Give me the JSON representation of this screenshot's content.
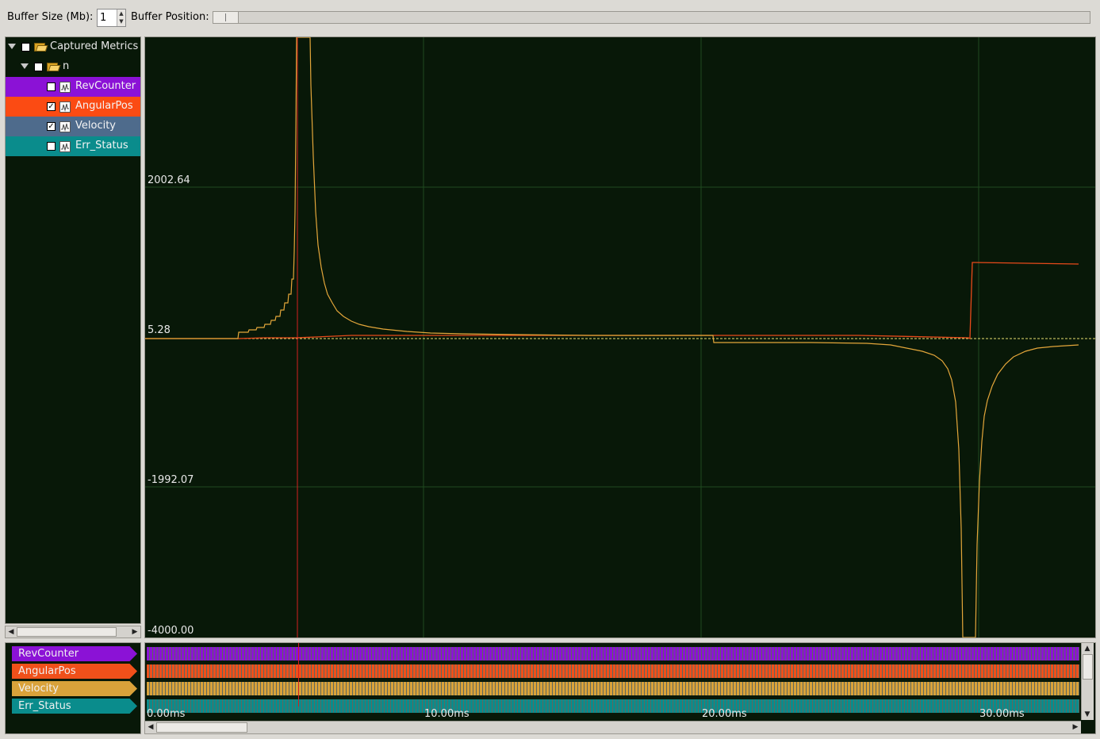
{
  "toolbar": {
    "buffer_size_label": "Buffer Size (Mb):",
    "buffer_size_value": "1",
    "buffer_position_label": "Buffer Position:"
  },
  "tree": {
    "root": {
      "label": "Captured Metrics",
      "checked": false,
      "icon": "folder-open-icon"
    },
    "group": {
      "label": "n",
      "checked": false,
      "icon": "folder-open-icon"
    },
    "signals": [
      {
        "label": "RevCounter",
        "checked": false,
        "color": "#8b12d6",
        "icon": "waveform-icon"
      },
      {
        "label": "AngularPos",
        "checked": true,
        "color": "#fb4b13",
        "icon": "waveform-icon"
      },
      {
        "label": "Velocity",
        "checked": true,
        "color": "#4e6b8c",
        "icon": "waveform-icon"
      },
      {
        "label": "Err_Status",
        "checked": false,
        "color": "#0a8c8c",
        "icon": "waveform-icon"
      }
    ]
  },
  "plot": {
    "y_labels": [
      "2002.64",
      "5.28",
      "-1992.07",
      "-4000.00"
    ],
    "x_labels": [
      "0.00ms",
      "10.00ms",
      "20.00ms",
      "30.00ms"
    ],
    "colors": {
      "background": "#081808",
      "grid": "#1f4a1f",
      "velocity": "#e3a63a",
      "angularpos": "#e84a1a",
      "zero_line": "#e8e070",
      "cursor": "#d42020"
    }
  },
  "timeline": {
    "tags": [
      {
        "label": "RevCounter",
        "color": "#8b12d6"
      },
      {
        "label": "AngularPos",
        "color": "#f0501a"
      },
      {
        "label": "Velocity",
        "color": "#d9a23a"
      },
      {
        "label": "Err_Status",
        "color": "#0a8c8c"
      }
    ]
  }
}
